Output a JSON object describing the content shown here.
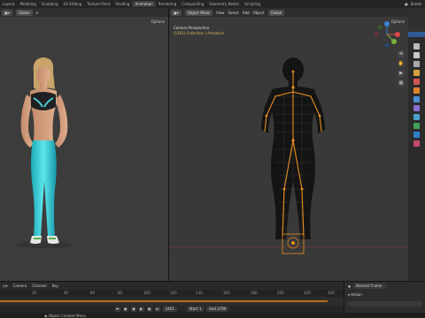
{
  "workspaces": [
    {
      "label": "Layout",
      "active": false
    },
    {
      "label": "Modeling",
      "active": false
    },
    {
      "label": "Sculpting",
      "active": false
    },
    {
      "label": "UV Editing",
      "active": false
    },
    {
      "label": "Texture Paint",
      "active": false
    },
    {
      "label": "Shading",
      "active": false
    },
    {
      "label": "Animation",
      "active": true
    },
    {
      "label": "Rendering",
      "active": false
    },
    {
      "label": "Compositing",
      "active": false
    },
    {
      "label": "Geometry Nodes",
      "active": false
    },
    {
      "label": "Scripting",
      "active": false
    }
  ],
  "scene_label": "Scene",
  "left_viewport": {
    "transform_orientation": "Global",
    "options_label": "Options"
  },
  "right_viewport": {
    "mode_label": "Object Mode",
    "menus": [
      "View",
      "Select",
      "Add",
      "Object"
    ],
    "transform_orientation": "Global",
    "options_label": "Options",
    "camera_title": "Camera Perspective",
    "camera_subtitle": "(1401) Collection | Armature"
  },
  "timeline": {
    "menus": [
      "Camera",
      "Channel",
      "Key"
    ],
    "ruler_ticks": [
      "20",
      "40",
      "60",
      "80",
      "100",
      "120",
      "140",
      "160",
      "180",
      "200",
      "220",
      "240"
    ],
    "current_frame": "1401",
    "start_label": "Start",
    "start_value": "1",
    "end_label": "End",
    "end_value": "2700"
  },
  "action_panel": {
    "keying_label": "Nearest Frame",
    "section_label": "Action"
  },
  "status_bar": {
    "text": "Object Context Menu"
  },
  "colors": {
    "accent": "#b76d1c",
    "active_blue": "#2f5b95",
    "axis_x": "#d8464b",
    "axis_y": "#7ab43c",
    "axis_z": "#3d7fd6"
  }
}
